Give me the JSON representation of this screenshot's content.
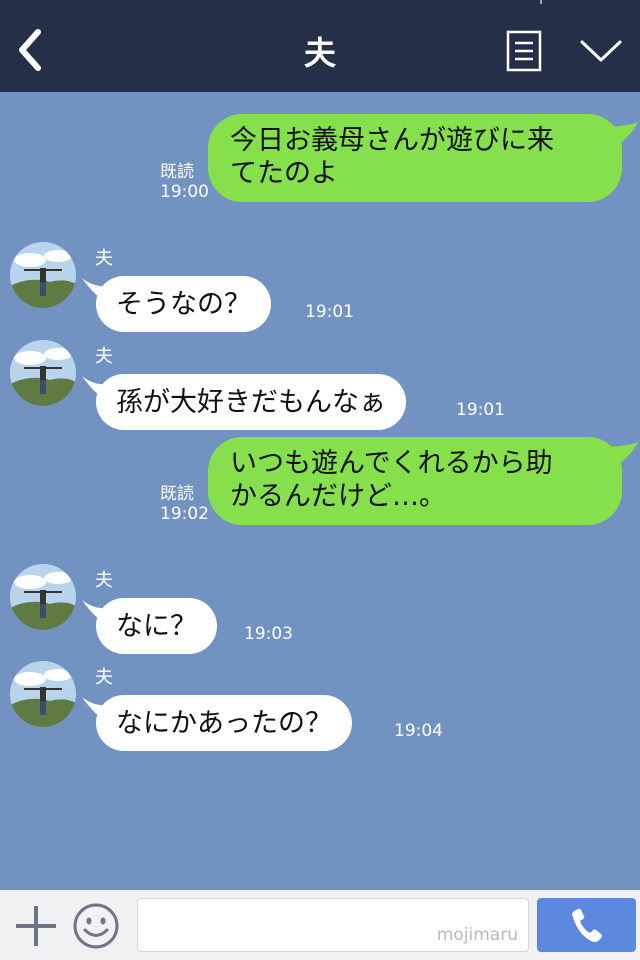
{
  "header": {
    "title": "夫"
  },
  "messages": [
    {
      "dir": "out",
      "line1": "今日お義母さんが遊びに来",
      "line2": "てたのよ",
      "read": "既読",
      "time": "19:00"
    },
    {
      "dir": "in",
      "sender": "夫",
      "text": "そうなの？",
      "time": "19:01"
    },
    {
      "dir": "in",
      "sender": "夫",
      "text": "孫が大好きだもんなぁ",
      "time": "19:01"
    },
    {
      "dir": "out",
      "line1": "いつも遊んでくれるから助",
      "line2": "かるんだけど…。",
      "read": "既読",
      "time": "19:02"
    },
    {
      "dir": "in",
      "sender": "夫",
      "text": "なに？",
      "time": "19:03"
    },
    {
      "dir": "in",
      "sender": "夫",
      "text": "なにかあったの？",
      "time": "19:04"
    }
  ],
  "input": {
    "watermark": "mojimaru"
  },
  "colors": {
    "header": "#243047",
    "chat_bg": "#7293c2",
    "out_bubble": "#86e04c",
    "in_bubble": "#ffffff",
    "call_button": "#5c88e0"
  },
  "icons": [
    "back-icon",
    "menu-icon",
    "chevron-down-icon",
    "plus-icon",
    "smiley-icon",
    "phone-icon"
  ]
}
